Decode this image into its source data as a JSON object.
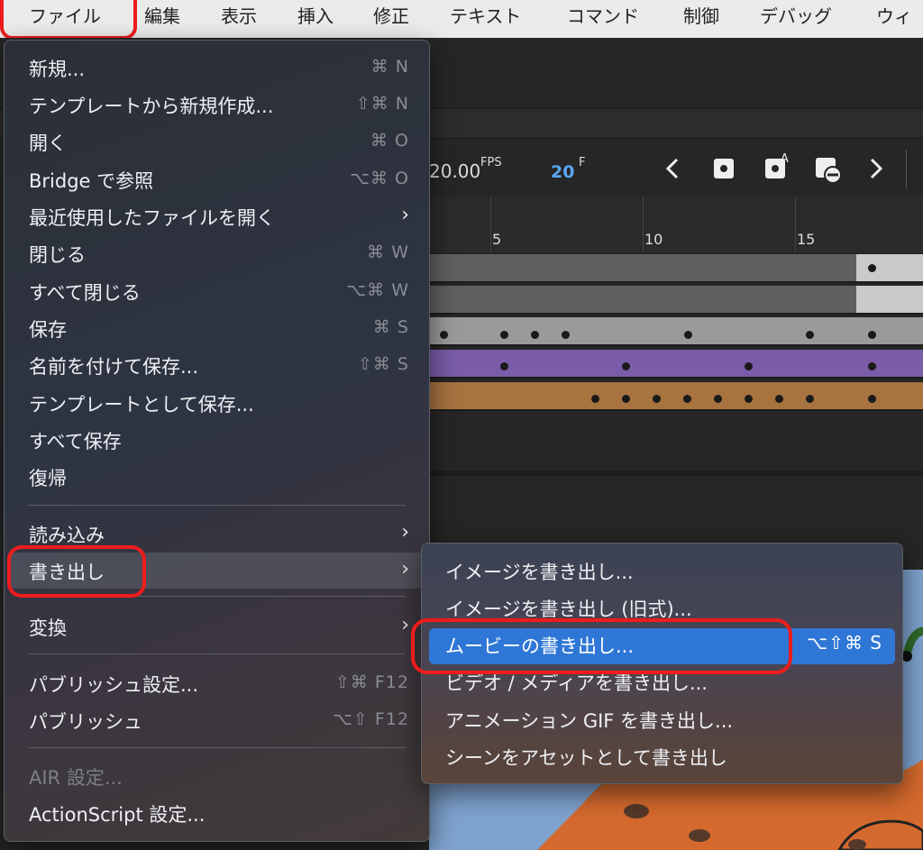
{
  "menubar": {
    "items": [
      "ファイル",
      "編集",
      "表示",
      "挿入",
      "修正",
      "テキスト",
      "コマンド",
      "制御",
      "デバッグ",
      "ウィ"
    ]
  },
  "timeline": {
    "fps": "20.00",
    "fps_unit": "FPS",
    "frame": "20",
    "frame_unit": "F",
    "ruler": [
      "5",
      "10",
      "15"
    ]
  },
  "file_menu": {
    "items": [
      {
        "label": "新規...",
        "shortcut": "⌘ N"
      },
      {
        "label": "テンプレートから新規作成...",
        "shortcut": "⇧⌘ N"
      },
      {
        "label": "開く",
        "shortcut": "⌘ O"
      },
      {
        "label": "Bridge で参照",
        "shortcut": "⌥⌘ O"
      },
      {
        "label": "最近使用したファイルを開く",
        "shortcut": ""
      },
      {
        "label": "閉じる",
        "shortcut": "⌘ W"
      },
      {
        "label": "すべて閉じる",
        "shortcut": "⌥⌘ W"
      },
      {
        "label": "保存",
        "shortcut": "⌘ S"
      },
      {
        "label": "名前を付けて保存...",
        "shortcut": "⇧⌘ S"
      },
      {
        "label": "テンプレートとして保存...",
        "shortcut": ""
      },
      {
        "label": "すべて保存",
        "shortcut": ""
      },
      {
        "label": "復帰",
        "shortcut": ""
      },
      {
        "label": "読み込み",
        "shortcut": ""
      },
      {
        "label": "書き出し",
        "shortcut": ""
      },
      {
        "label": "変換",
        "shortcut": ""
      },
      {
        "label": "パブリッシュ設定...",
        "shortcut": "⇧⌘ F12"
      },
      {
        "label": "パブリッシュ",
        "shortcut": "⌥⇧ F12"
      },
      {
        "label": "AIR 設定...",
        "shortcut": ""
      },
      {
        "label": "ActionScript 設定...",
        "shortcut": ""
      }
    ]
  },
  "export_menu": {
    "items": [
      {
        "label": "イメージを書き出し...",
        "shortcut": ""
      },
      {
        "label": "イメージを書き出し (旧式)...",
        "shortcut": ""
      },
      {
        "label": "ムービーの書き出し...",
        "shortcut": "⌥⇧⌘ S"
      },
      {
        "label": "ビデオ / メディアを書き出し...",
        "shortcut": ""
      },
      {
        "label": "アニメーション GIF を書き出し...",
        "shortcut": ""
      },
      {
        "label": "シーンをアセットとして書き出し",
        "shortcut": ""
      }
    ]
  },
  "colors": {
    "highlight": "#ee1c1c",
    "selection": "#2f77d6",
    "track_purple": "#7a5ca8",
    "track_orange": "#a7733f",
    "track_gray": "#9a9a9a",
    "stage_blue": "#7fa3cf"
  },
  "icons": [
    "prev-keyframe-icon",
    "insert-keyframe-icon",
    "insert-blank-keyframe-icon",
    "clear-keyframe-icon",
    "next-keyframe-icon",
    "chevron-right-icon"
  ]
}
